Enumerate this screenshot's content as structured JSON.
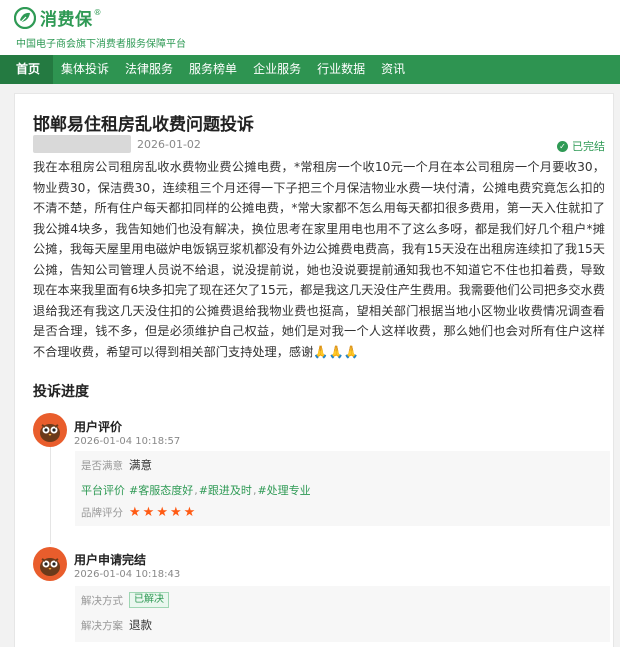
{
  "header": {
    "logo_text": "消费保",
    "logo_mark": "registered",
    "subtitle": "中国电子商会旗下消费者服务保障平台"
  },
  "nav": {
    "items": [
      {
        "label": "首页",
        "active": true
      },
      {
        "label": "集体投诉",
        "active": false
      },
      {
        "label": "法律服务",
        "active": false
      },
      {
        "label": "服务榜单",
        "active": false
      },
      {
        "label": "企业服务",
        "active": false
      },
      {
        "label": "行业数据",
        "active": false
      },
      {
        "label": "资讯",
        "active": false
      }
    ]
  },
  "complaint": {
    "title": "邯郸易住租房乱收费问题投诉",
    "date": "2026-01-02",
    "status": "已完结",
    "content": "我在本租房公司租房乱收水费物业费公摊电费，*常租房一个收10元一个月在本公司租房一个月要收30，物业费30，保洁费30，连续租三个月还得一下子把三个月保洁物业水费一块付清，公摊电费究竟怎么扣的不清不楚，所有住户每天都扣同样的公摊电费，*常大家都不怎么用每天都扣很多费用，第一天入住就扣了我公摊4块多，我告知她们也没有解决，换位思考在家里用电也用不了这么多呀，都是我们好几个租户*摊公摊，我每天屋里用电磁炉电饭锅豆浆机都没有外边公摊费电费高，我有15天没在出租房连续扣了我15天公摊，告知公司管理人员说不给退，说没提前说，她也没说要提前通知我也不知道它不住也扣着费，导致现在本来我里面有6块多扣完了现在还欠了15元，都是我这几天没住产生费用。我需要他们公司把多交水费退给我还有我这几天没住扣的公摊费退给我物业费也挺高，望相关部门根据当地小区物业收费情况调查看是否合理，钱不多，但是必须维护自己权益，她们是对我一个人这样收费，那么她们也会对所有住户这样不合理收费，希望可以得到相关部门支持处理，感谢🙏🙏🙏"
  },
  "progress": {
    "section_title": "投诉进度",
    "steps": [
      {
        "title": "用户评价",
        "time": "2026-01-04 10:18:57",
        "details": {
          "satisfaction_label": "是否满意",
          "satisfaction_value": "满意",
          "platform_label": "平台评价",
          "tags": [
            "#客服态度好",
            "#跟进及时",
            "#处理专业"
          ],
          "rating_label": "品牌评分",
          "rating": 5,
          "max_rating": 5
        }
      },
      {
        "title": "用户申请完结",
        "time": "2026-01-04 10:18:43",
        "details": {
          "method_label": "解决方式",
          "method_badge": "已解决",
          "resolution_label": "解决方案",
          "resolution_value": "退款"
        }
      }
    ]
  },
  "colors": {
    "brand_green": "#2f9a55",
    "nav_bg": "#2e9451",
    "star_orange": "#ff5b14",
    "avatar_bg": "#e95d2c"
  }
}
